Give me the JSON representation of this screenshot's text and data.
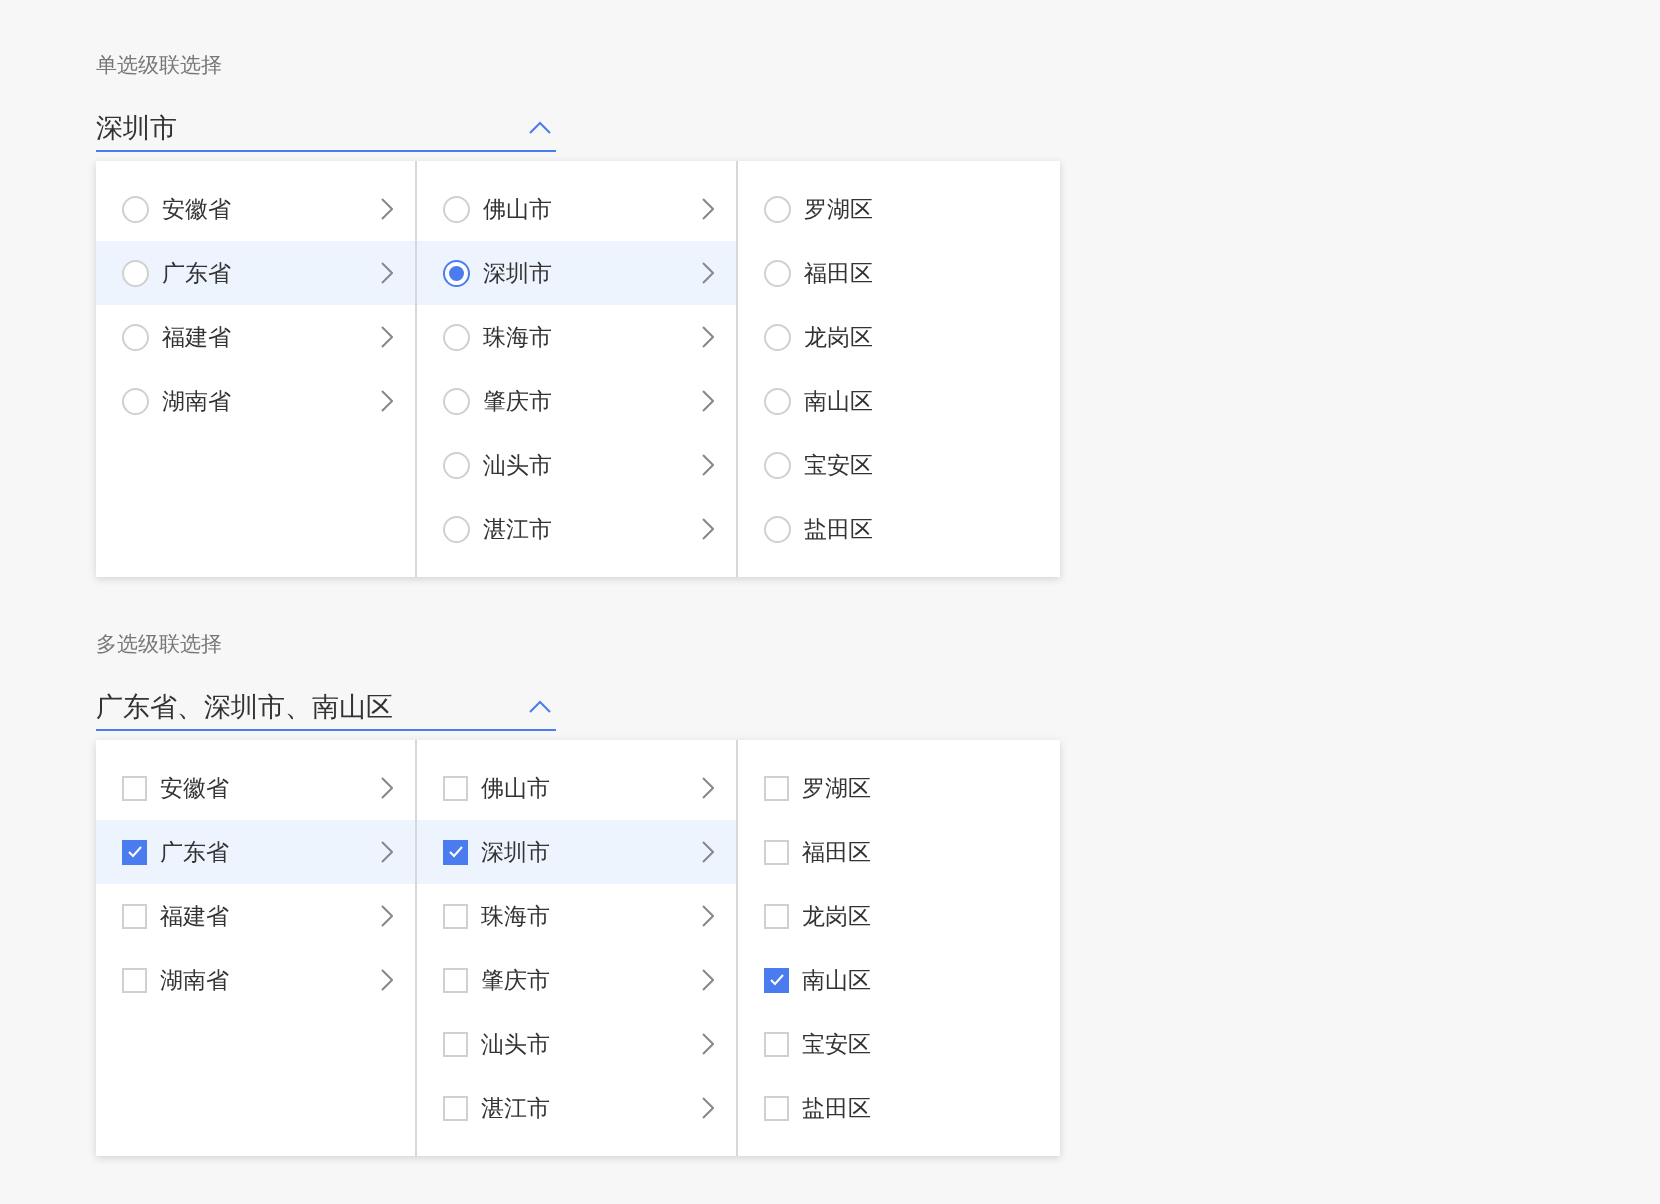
{
  "sections": [
    {
      "label": "单选级联选择",
      "kind": "radio",
      "value": "深圳市",
      "expanded": true,
      "columns": [
        {
          "items": [
            {
              "label": "安徽省",
              "selected": false,
              "active": false,
              "has_children": true
            },
            {
              "label": "广东省",
              "selected": false,
              "active": true,
              "has_children": true
            },
            {
              "label": "福建省",
              "selected": false,
              "active": false,
              "has_children": true
            },
            {
              "label": "湖南省",
              "selected": false,
              "active": false,
              "has_children": true
            }
          ]
        },
        {
          "items": [
            {
              "label": "佛山市",
              "selected": false,
              "active": false,
              "has_children": true
            },
            {
              "label": "深圳市",
              "selected": true,
              "active": true,
              "has_children": true
            },
            {
              "label": "珠海市",
              "selected": false,
              "active": false,
              "has_children": true
            },
            {
              "label": "肇庆市",
              "selected": false,
              "active": false,
              "has_children": true
            },
            {
              "label": "汕头市",
              "selected": false,
              "active": false,
              "has_children": true
            },
            {
              "label": "湛江市",
              "selected": false,
              "active": false,
              "has_children": true
            }
          ]
        },
        {
          "items": [
            {
              "label": "罗湖区",
              "selected": false,
              "active": false,
              "has_children": false
            },
            {
              "label": "福田区",
              "selected": false,
              "active": false,
              "has_children": false
            },
            {
              "label": "龙岗区",
              "selected": false,
              "active": false,
              "has_children": false
            },
            {
              "label": "南山区",
              "selected": false,
              "active": false,
              "has_children": false
            },
            {
              "label": "宝安区",
              "selected": false,
              "active": false,
              "has_children": false
            },
            {
              "label": "盐田区",
              "selected": false,
              "active": false,
              "has_children": false
            }
          ]
        }
      ]
    },
    {
      "label": "多选级联选择",
      "kind": "checkbox",
      "value": "广东省、深圳市、南山区",
      "expanded": true,
      "columns": [
        {
          "items": [
            {
              "label": "安徽省",
              "checked": false,
              "active": false,
              "has_children": true
            },
            {
              "label": "广东省",
              "checked": true,
              "active": true,
              "has_children": true
            },
            {
              "label": "福建省",
              "checked": false,
              "active": false,
              "has_children": true
            },
            {
              "label": "湖南省",
              "checked": false,
              "active": false,
              "has_children": true
            }
          ]
        },
        {
          "items": [
            {
              "label": "佛山市",
              "checked": false,
              "active": false,
              "has_children": true
            },
            {
              "label": "深圳市",
              "checked": true,
              "active": true,
              "has_children": true
            },
            {
              "label": "珠海市",
              "checked": false,
              "active": false,
              "has_children": true
            },
            {
              "label": "肇庆市",
              "checked": false,
              "active": false,
              "has_children": true
            },
            {
              "label": "汕头市",
              "checked": false,
              "active": false,
              "has_children": true
            },
            {
              "label": "湛江市",
              "checked": false,
              "active": false,
              "has_children": true
            }
          ]
        },
        {
          "items": [
            {
              "label": "罗湖区",
              "checked": false,
              "active": false,
              "has_children": false
            },
            {
              "label": "福田区",
              "checked": false,
              "active": false,
              "has_children": false
            },
            {
              "label": "龙岗区",
              "checked": false,
              "active": false,
              "has_children": false
            },
            {
              "label": "南山区",
              "checked": true,
              "active": false,
              "has_children": false
            },
            {
              "label": "宝安区",
              "checked": false,
              "active": false,
              "has_children": false
            },
            {
              "label": "盐田区",
              "checked": false,
              "active": false,
              "has_children": false
            }
          ]
        }
      ]
    }
  ]
}
